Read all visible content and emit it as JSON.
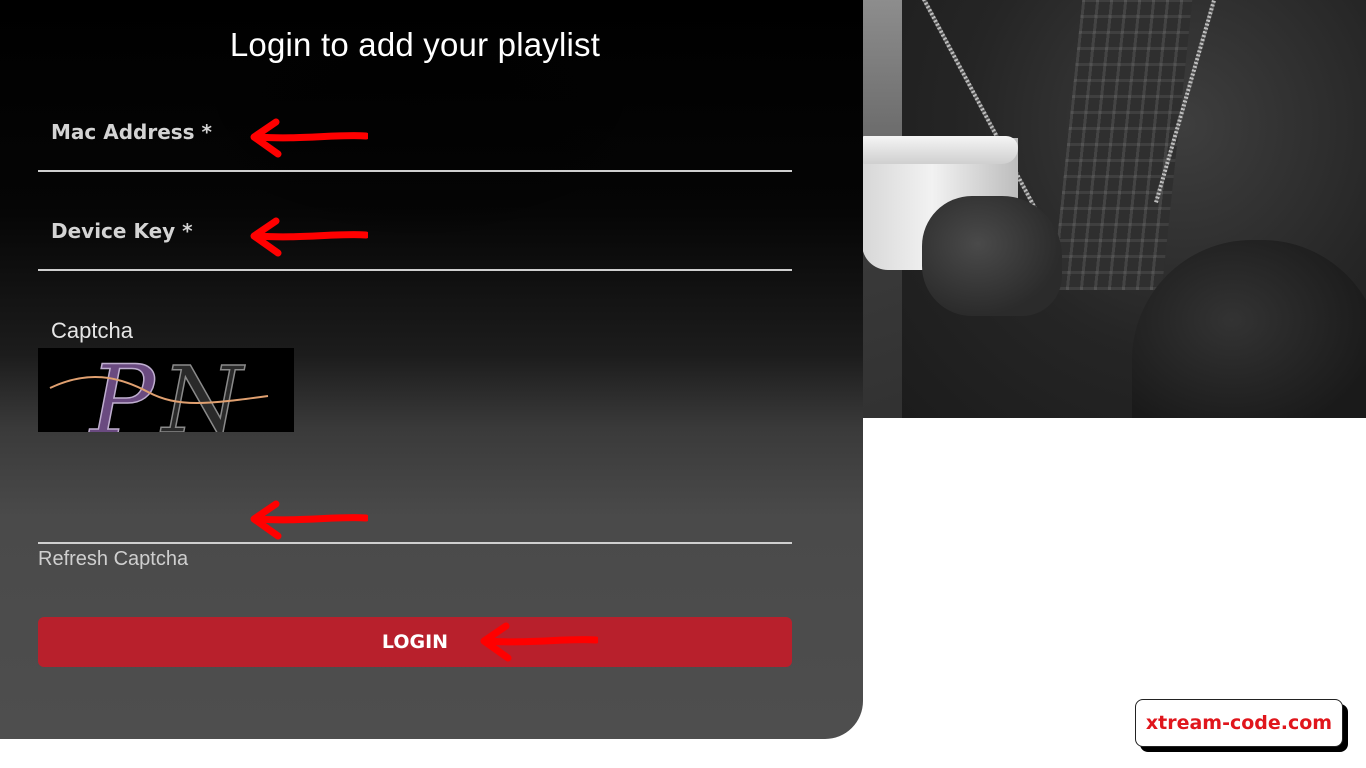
{
  "page": {
    "title": "Login to add your playlist"
  },
  "form": {
    "mac_label": "Mac Address *",
    "mac_value": "",
    "device_key_label": "Device Key *",
    "device_key_value": "",
    "captcha_label": "Captcha",
    "captcha_text": "PN",
    "captcha_value": "",
    "refresh_captcha_label": "Refresh Captcha",
    "login_label": "LOGIN"
  },
  "watermark": {
    "text": "xtream-code.com"
  },
  "colors": {
    "login_button": "#b8202c",
    "arrow": "#ff0000",
    "watermark_text": "#e0161c"
  },
  "icons": {
    "annotation_arrow": "arrow-left-icon"
  }
}
